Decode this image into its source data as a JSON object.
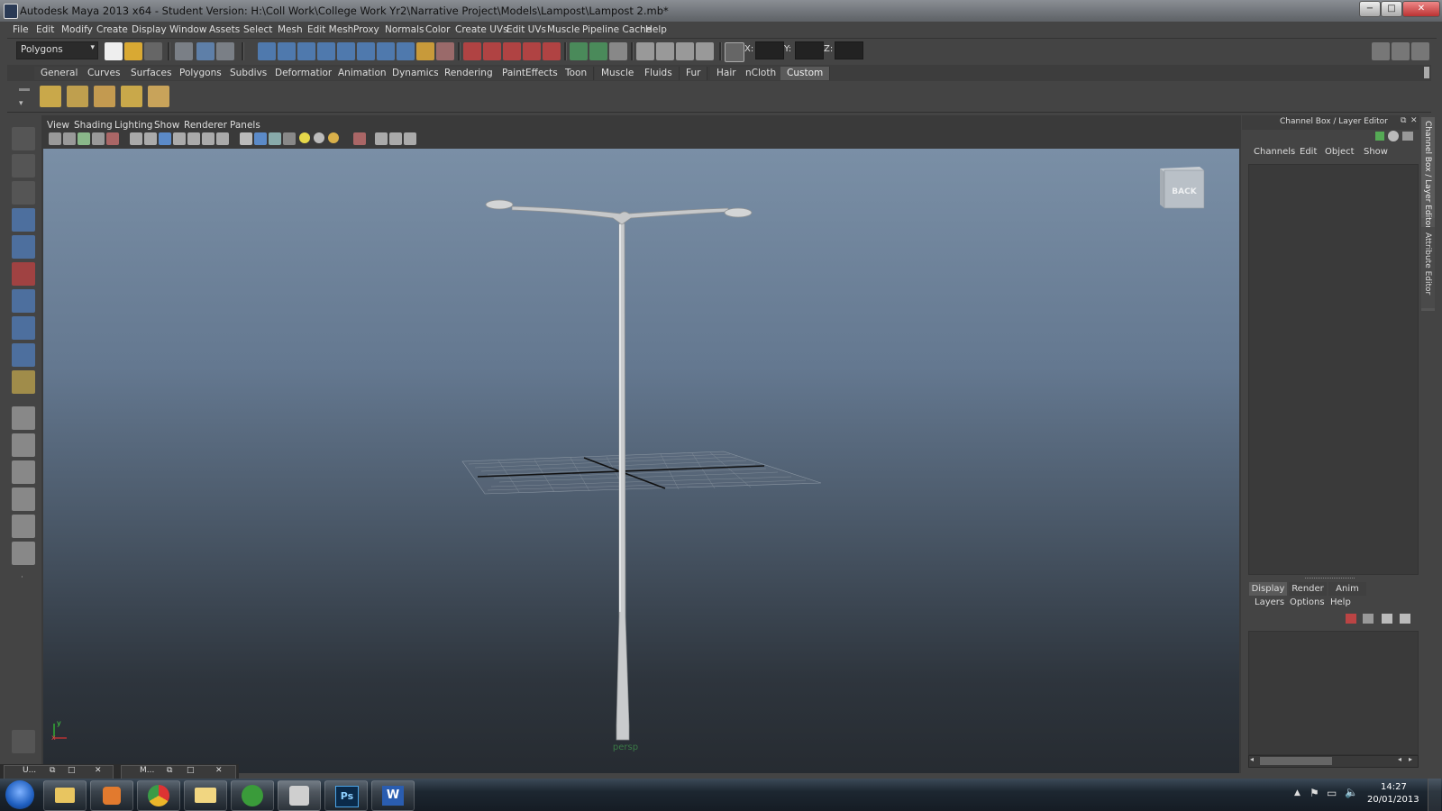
{
  "window": {
    "title": "Autodesk Maya 2013 x64 - Student Version: H:\\Coll Work\\College Work Yr2\\Narrative Project\\Models\\Lampost\\Lampost 2.mb*",
    "minimize": "−",
    "maximize": "□",
    "close": "✕"
  },
  "menubar": [
    "File",
    "Edit",
    "Modify",
    "Create",
    "Display",
    "Window",
    "Assets",
    "Select",
    "Mesh",
    "Edit Mesh",
    "Proxy",
    "Normals",
    "Color",
    "Create UVs",
    "Edit UVs",
    "Muscle",
    "Pipeline Cache",
    "Help"
  ],
  "statusline": {
    "mode": "Polygons",
    "x_label": "X:",
    "y_label": "Y:",
    "z_label": "Z:"
  },
  "shelf": {
    "tabs": [
      "General",
      "Curves",
      "Surfaces",
      "Polygons",
      "Subdivs",
      "Deformation",
      "Animation",
      "Dynamics",
      "Rendering",
      "PaintEffects",
      "Toon",
      "Muscle",
      "Fluids",
      "Fur",
      "Hair",
      "nCloth",
      "Custom"
    ],
    "active_tab": "Custom"
  },
  "viewport": {
    "menu": [
      "View",
      "Shading",
      "Lighting",
      "Show",
      "Renderer",
      "Panels"
    ],
    "camera_label": "persp",
    "viewcube_label": "BACK",
    "axis_x": "x",
    "axis_y": "y"
  },
  "channel_box": {
    "title": "Channel Box / Layer Editor",
    "menu": [
      "Channels",
      "Edit",
      "Object",
      "Show"
    ],
    "side_tab_1": "Channel Box / Layer Editor",
    "side_tab_2": "Attribute Editor"
  },
  "layer_editor": {
    "tabs": [
      "Display",
      "Render",
      "Anim"
    ],
    "active_tab": "Display",
    "menu": [
      "Layers",
      "Options",
      "Help"
    ]
  },
  "minimized_windows": [
    "U...",
    "M..."
  ],
  "taskbar": {
    "apps": [
      "start-orb",
      "explorer",
      "media-player",
      "chrome",
      "folder",
      "utorrent",
      "maya",
      "photoshop",
      "word"
    ],
    "ps_label": "Ps",
    "word_label": "W",
    "time": "14:27",
    "date": "20/01/2013"
  },
  "colors": {
    "ui_bg": "#444444",
    "active_tab": "#5a5a5a",
    "viewport_top": "#7a8fa6",
    "viewport_bottom": "#262b31"
  }
}
